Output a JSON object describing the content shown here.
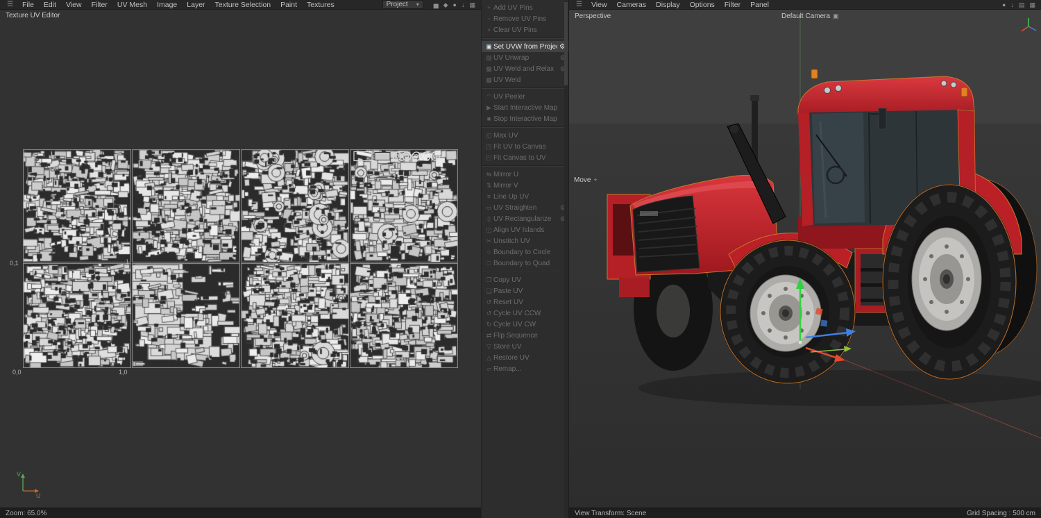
{
  "uv_editor": {
    "title": "Texture UV Editor",
    "menu": [
      "File",
      "Edit",
      "View",
      "Filter",
      "UV Mesh",
      "Image",
      "Layer",
      "Texture Selection",
      "Paint",
      "Textures"
    ],
    "project_dropdown": {
      "label": "Project"
    },
    "toolbar_icons": [
      {
        "name": "histogram-icon",
        "glyph": "▅"
      },
      {
        "name": "lock-icon",
        "glyph": "◆"
      },
      {
        "name": "record-icon",
        "glyph": "●"
      },
      {
        "name": "download-icon",
        "glyph": "↓"
      },
      {
        "name": "grid-icon",
        "glyph": "▦"
      }
    ],
    "coords": {
      "top_left": "0,1",
      "top_right": "1",
      "bottom_left": "0,0",
      "bottom_right": "1,0"
    },
    "axes": {
      "u": "U",
      "v": "V"
    },
    "status_zoom": "Zoom: 65.0%"
  },
  "command_panel": {
    "groups": [
      [
        {
          "label": "Add UV Pins",
          "icon": "+"
        },
        {
          "label": "Remove UV Pins",
          "icon": "−"
        },
        {
          "label": "Clear UV Pins",
          "icon": "×"
        }
      ],
      [
        {
          "label": "Set UVW from Projection",
          "icon": "▣",
          "gear": true,
          "state": "selected"
        },
        {
          "label": "UV Unwrap",
          "icon": "▨",
          "gear": true
        },
        {
          "label": "UV Weld and Relax",
          "icon": "▩",
          "gear": true
        },
        {
          "label": "UV Weld",
          "icon": "▦"
        }
      ],
      [
        {
          "label": "UV Peeler",
          "icon": "◠"
        },
        {
          "label": "Start Interactive Mapping",
          "icon": "▶"
        },
        {
          "label": "Stop Interactive Mapping",
          "icon": "■"
        }
      ],
      [
        {
          "label": "Max UV",
          "icon": "◱"
        },
        {
          "label": "Fit UV to Canvas",
          "icon": "◳"
        },
        {
          "label": "Fit Canvas to UV",
          "icon": "◰"
        }
      ],
      [
        {
          "label": "Mirror U",
          "icon": "⇋"
        },
        {
          "label": "Mirror V",
          "icon": "⇅"
        },
        {
          "label": "Line Up UV",
          "icon": "≡"
        },
        {
          "label": "UV Straighten",
          "icon": "▭",
          "gear": true
        },
        {
          "label": "UV Rectangularize",
          "icon": "▯",
          "gear": true
        },
        {
          "label": "Align UV Islands",
          "icon": "◫"
        },
        {
          "label": "Unstitch UV",
          "icon": "✂"
        },
        {
          "label": "Boundary to Circle",
          "icon": "○"
        },
        {
          "label": "Boundary to Quad",
          "icon": "□"
        }
      ],
      [
        {
          "label": "Copy UV",
          "icon": "❐"
        },
        {
          "label": "Paste UV",
          "icon": "❏"
        },
        {
          "label": "Reset UV",
          "icon": "↺"
        },
        {
          "label": "Cycle UV CCW",
          "icon": "↺"
        },
        {
          "label": "Cycle UV CW",
          "icon": "↻"
        },
        {
          "label": "Flip Sequence",
          "icon": "⇄"
        },
        {
          "label": "Store UV",
          "icon": "▽"
        },
        {
          "label": "Restore UV",
          "icon": "△"
        },
        {
          "label": "Remap...",
          "icon": "▱"
        }
      ]
    ]
  },
  "viewport": {
    "menu": [
      "View",
      "Cameras",
      "Display",
      "Options",
      "Filter",
      "Panel"
    ],
    "toolbar_icons": [
      {
        "name": "record-icon",
        "glyph": "●"
      },
      {
        "name": "download-icon",
        "glyph": "↓"
      },
      {
        "name": "layers-icon",
        "glyph": "▤"
      },
      {
        "name": "grid-icon",
        "glyph": "▦"
      }
    ],
    "perspective_label": "Perspective",
    "camera_label": "Default Camera",
    "tool_hint": "Move",
    "status_left": "View Transform: Scene",
    "status_right": "Grid Spacing : 500 cm"
  },
  "colors": {
    "tractor_red": "#c4232a",
    "selection_orange": "#cf7a2e",
    "gizmo_green": "#2fd23f",
    "gizmo_red": "#e04b2f",
    "gizmo_blue": "#3f80e0"
  }
}
